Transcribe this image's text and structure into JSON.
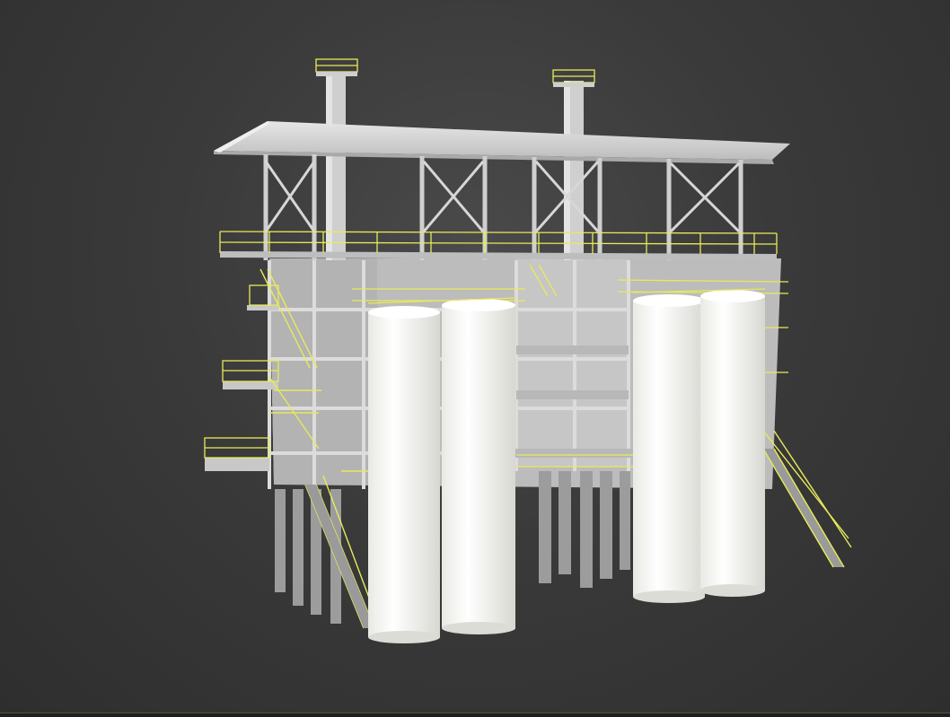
{
  "viewport": {
    "background": "#3a3a3a",
    "view": "perspective"
  },
  "model": {
    "structure_color": "#c9c9c9",
    "roof_color": "#d7d7d7",
    "wall_color": "#bdbdbd",
    "vessel_color": "#f4f4f0",
    "railing_color": "#e8ea5a",
    "contents": [
      "steel-frame-structure",
      "roof",
      "stacks",
      "vessels",
      "platforms",
      "stairs",
      "railings"
    ]
  }
}
